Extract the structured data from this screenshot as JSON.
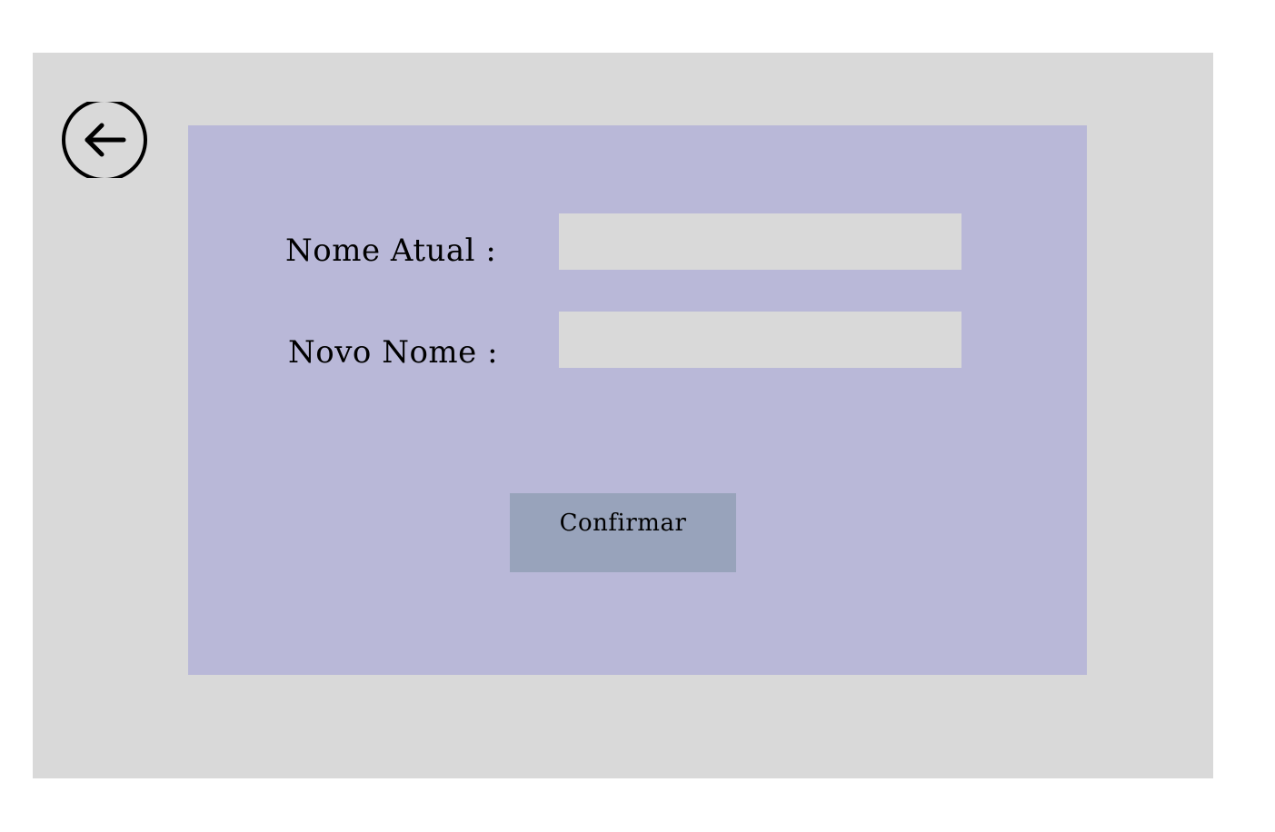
{
  "icons": {
    "back": "arrow-left-circle-icon"
  },
  "form": {
    "current_name_label": "Nome Atual :",
    "current_name_value": "",
    "new_name_label": "Novo Nome :",
    "new_name_value": "",
    "confirm_label": "Confirmar"
  },
  "colors": {
    "page_background": "#ffffff",
    "frame_background": "#d9d9d9",
    "panel_background": "#b9b8d8",
    "input_background": "#d9d9d9",
    "button_background": "#98a3bb",
    "text": "#000000"
  }
}
